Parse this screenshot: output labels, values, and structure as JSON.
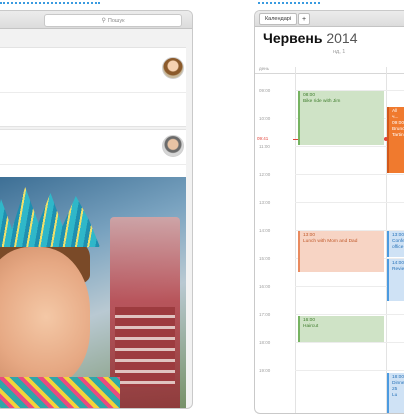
{
  "left_window": {
    "search_placeholder": "Пошук",
    "search_icon": "search-icon"
  },
  "calendar": {
    "toolbar": {
      "calendars_button": "Календарі",
      "add_button": "+"
    },
    "month": "Червень",
    "year": "2014",
    "week": "нд, 1",
    "allday_label": "день",
    "hours": [
      "09:00",
      "10:00",
      "11:00",
      "12:00",
      "13:00",
      "14:00",
      "15:00",
      "16:00",
      "17:00",
      "18:00",
      "19:00"
    ],
    "now_time": "09:41",
    "events": [
      {
        "time": "08:00",
        "title": "Bike ride with Jim",
        "color": "green"
      },
      {
        "time": "13:00",
        "title": "Lunch with Mom and Dad",
        "color": "salmon"
      },
      {
        "time": "16:00",
        "title": "Haircut",
        "color": "green"
      },
      {
        "time": "All day / 09:00",
        "title": "Brunch / Tarte...",
        "color": "orange",
        "line1": "All ч...",
        "line2": "09:00",
        "line3": "Brunc",
        "line4": "Tartin"
      },
      {
        "time": "13:00",
        "title": "Conference office",
        "color": "blue",
        "line1": "13:00",
        "line2": "Confe",
        "line3": "office"
      },
      {
        "time": "14:00",
        "title": "Review",
        "color": "blue",
        "line1": "14:00",
        "line2": "Revie"
      },
      {
        "time": "18:00",
        "title": "Dinner 25 Lu",
        "color": "blue",
        "line1": "18:00",
        "line2": "Dinne",
        "line3": "25 Lu"
      }
    ]
  },
  "colors": {
    "accent_blue": "#3a9be0",
    "now_red": "#e2453c"
  }
}
